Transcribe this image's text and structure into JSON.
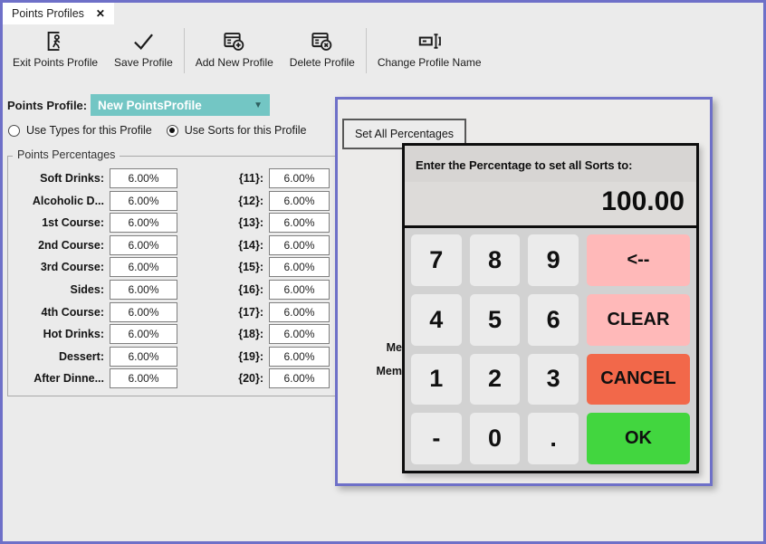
{
  "colors": {
    "accent_border": "#6e70c8",
    "window_bg": "#ebebeb",
    "dropdown_teal": "#73c6c4",
    "key_digit_bg": "#ebebeb",
    "key_warn_bg": "#ffb9b9",
    "key_cancel_bg": "#f2684a",
    "key_ok_bg": "#42d63f"
  },
  "tab": {
    "title": "Points Profiles",
    "close_label": "✕"
  },
  "toolbar": {
    "separators_after": [
      1,
      3
    ],
    "items": [
      {
        "name": "exit-points-profile",
        "label": "Exit Points Profile",
        "icon": "exit-door-icon"
      },
      {
        "name": "save-profile",
        "label": "Save Profile",
        "icon": "checkmark-icon"
      },
      {
        "name": "add-new-profile",
        "label": "Add New Profile",
        "icon": "profile-card-plus-icon"
      },
      {
        "name": "delete-profile",
        "label": "Delete Profile",
        "icon": "profile-card-delete-icon"
      },
      {
        "name": "change-profile-name",
        "label": "Change Profile Name",
        "icon": "rename-icon"
      }
    ]
  },
  "profile_row": {
    "label": "Points Profile:",
    "dropdown_value": "New PointsProfile",
    "dropdown_arrow": "▼"
  },
  "radio_group": [
    {
      "label": "Use Types for this Profile",
      "selected": false
    },
    {
      "label": "Use Sorts for this Profile",
      "selected": true
    }
  ],
  "points_percentages": {
    "title": "Points Percentages",
    "left_rows": [
      {
        "label": "Soft Drinks:",
        "value": "6.00%"
      },
      {
        "label": "Alcoholic D...",
        "value": "6.00%"
      },
      {
        "label": "1st Course:",
        "value": "6.00%"
      },
      {
        "label": "2nd Course:",
        "value": "6.00%"
      },
      {
        "label": "3rd Course:",
        "value": "6.00%"
      },
      {
        "label": "Sides:",
        "value": "6.00%"
      },
      {
        "label": "4th Course:",
        "value": "6.00%"
      },
      {
        "label": "Hot Drinks:",
        "value": "6.00%"
      },
      {
        "label": "Dessert:",
        "value": "6.00%"
      },
      {
        "label": "After Dinne...",
        "value": "6.00%"
      }
    ],
    "right_rows": [
      {
        "label": "{11}:",
        "value": "6.00%"
      },
      {
        "label": "{12}:",
        "value": "6.00%"
      },
      {
        "label": "{13}:",
        "value": "6.00%"
      },
      {
        "label": "{14}:",
        "value": "6.00%"
      },
      {
        "label": "{15}:",
        "value": "6.00%"
      },
      {
        "label": "{16}:",
        "value": "6.00%"
      },
      {
        "label": "{17}:",
        "value": "6.00%"
      },
      {
        "label": "{18}:",
        "value": "6.00%"
      },
      {
        "label": "{19}:",
        "value": "6.00%"
      },
      {
        "label": "{20}:",
        "value": "6.00%"
      }
    ]
  },
  "overlay_panel": {
    "set_all_button_label": "Set All Percentages",
    "clipped_labels": [
      "Me",
      "Mem"
    ]
  },
  "keypad_dialog": {
    "prompt": "Enter the Percentage to set all Sorts to:",
    "display_value": "100.00",
    "keys": [
      [
        {
          "label": "7",
          "name": "7",
          "type": "digit"
        },
        {
          "label": "8",
          "name": "8",
          "type": "digit"
        },
        {
          "label": "9",
          "name": "9",
          "type": "digit"
        },
        {
          "label": "<--",
          "name": "backspace",
          "type": "warn"
        }
      ],
      [
        {
          "label": "4",
          "name": "4",
          "type": "digit"
        },
        {
          "label": "5",
          "name": "5",
          "type": "digit"
        },
        {
          "label": "6",
          "name": "6",
          "type": "digit"
        },
        {
          "label": "CLEAR",
          "name": "clear",
          "type": "warn"
        }
      ],
      [
        {
          "label": "1",
          "name": "1",
          "type": "digit"
        },
        {
          "label": "2",
          "name": "2",
          "type": "digit"
        },
        {
          "label": "3",
          "name": "3",
          "type": "digit"
        },
        {
          "label": "CANCEL",
          "name": "cancel",
          "type": "cancel"
        }
      ],
      [
        {
          "label": "-",
          "name": "minus",
          "type": "digit"
        },
        {
          "label": "0",
          "name": "0",
          "type": "digit"
        },
        {
          "label": ".",
          "name": "decimal",
          "type": "digit"
        },
        {
          "label": "OK",
          "name": "ok",
          "type": "ok"
        }
      ]
    ]
  }
}
